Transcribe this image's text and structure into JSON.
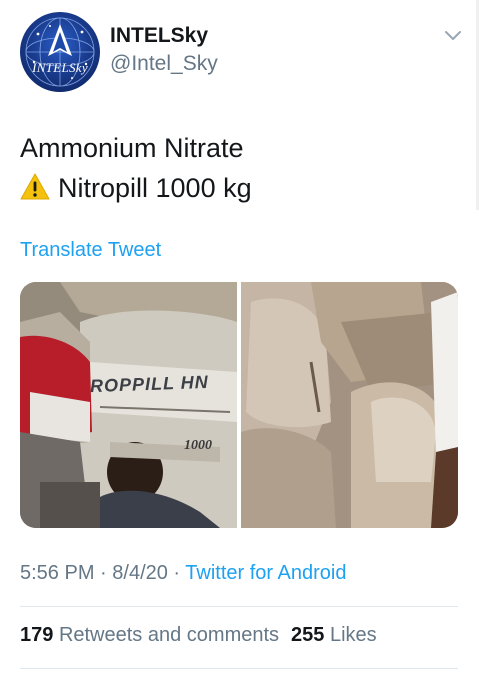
{
  "author": {
    "display_name": "INTELSky",
    "handle": "@Intel_Sky",
    "avatar_text": "INTELSky"
  },
  "tweet": {
    "line_1": "Ammonium Nitrate",
    "line_2": "Nitropill 1000 kg",
    "translate_label": "Translate Tweet"
  },
  "media": {
    "bag_label": "ROPPILL HN",
    "bag_weight": "1000"
  },
  "meta": {
    "time": "5:56 PM",
    "separator": " · ",
    "date": "8/4/20",
    "source": "Twitter for Android"
  },
  "stats": {
    "retweets_count": "179",
    "retweets_label": "Retweets and comments",
    "likes_count": "255",
    "likes_label": "Likes"
  },
  "colors": {
    "accent": "#1da1f2",
    "secondary_text": "#657786",
    "warning": "#f4c20d"
  },
  "icons": {
    "header_menu": "chevron-down-icon",
    "warning": "warning-icon"
  }
}
